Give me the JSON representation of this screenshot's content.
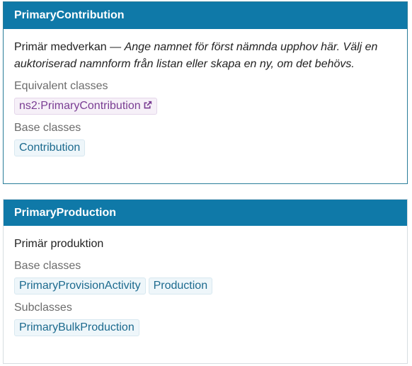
{
  "card1": {
    "title": "PrimaryContribution",
    "description_label": "Primär medverkan",
    "description_sep": " — ",
    "description_comment": "Ange namnet för först nämnda upphov här. Välj en auktoriserad namnform från listan eller skapa en ny, om det behövs.",
    "equivalent_label": "Equivalent classes",
    "equivalent": [
      "ns2:PrimaryContribution"
    ],
    "base_label": "Base classes",
    "base": [
      "Contribution"
    ]
  },
  "card2": {
    "title": "PrimaryProduction",
    "description_label": "Primär produktion",
    "base_label": "Base classes",
    "base": [
      "PrimaryProvisionActivity",
      "Production"
    ],
    "sub_label": "Subclasses",
    "sub": [
      "PrimaryBulkProduction"
    ]
  },
  "colors": {
    "header_bg": "#0f79a8",
    "chip_bg": "#eef6fa",
    "chip_text": "#1c6a8e",
    "ext_chip_text": "#7a3d93"
  },
  "icons": [
    "external-link-icon"
  ]
}
